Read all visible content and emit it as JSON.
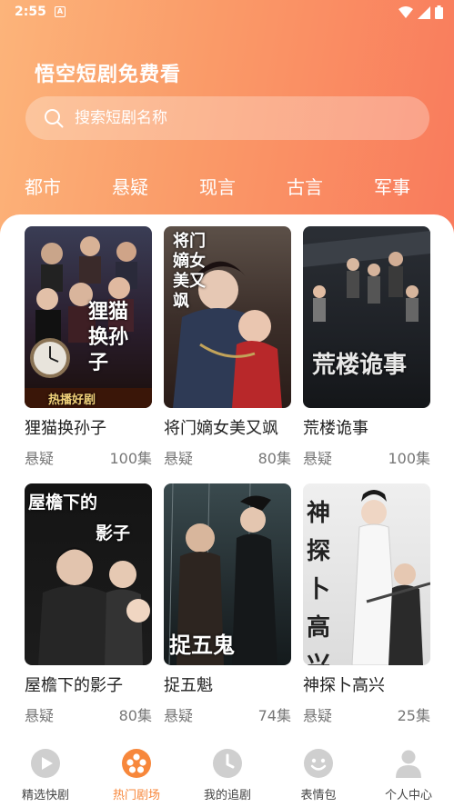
{
  "status_bar": {
    "time": "2:55",
    "notification_glyph": "A"
  },
  "header": {
    "app_title": "悟空短剧免费看",
    "search_placeholder": "搜索短剧名称"
  },
  "categories": [
    "都市",
    "悬疑",
    "现言",
    "古言",
    "军事"
  ],
  "dramas": [
    {
      "title": "狸猫换孙子",
      "genre": "悬疑",
      "episodes": "100集",
      "cover_text": "狸猫换孙子",
      "cover_tag": "热播好剧"
    },
    {
      "title": "将门嫡女美又飒",
      "genre": "悬疑",
      "episodes": "80集",
      "cover_text": "将门嫡女美又飒"
    },
    {
      "title": "荒楼诡事",
      "genre": "悬疑",
      "episodes": "100集",
      "cover_text": "荒楼诡事"
    },
    {
      "title": "屋檐下的影子",
      "genre": "悬疑",
      "episodes": "80集",
      "cover_text_1": "屋檐下的",
      "cover_text_2": "影子"
    },
    {
      "title": "捉五魁",
      "genre": "悬疑",
      "episodes": "74集",
      "cover_text": "捉五鬼"
    },
    {
      "title": "神探卜高兴",
      "genre": "悬疑",
      "episodes": "25集",
      "cover_text": "神探卜高兴"
    }
  ],
  "bottom_nav": [
    {
      "label": "精选快剧",
      "icon": "play-circle-icon"
    },
    {
      "label": "热门剧场",
      "icon": "film-reel-icon",
      "active": true
    },
    {
      "label": "我的追剧",
      "icon": "clock-icon"
    },
    {
      "label": "表情包",
      "icon": "smiley-icon"
    },
    {
      "label": "个人中心",
      "icon": "person-icon"
    }
  ],
  "colors": {
    "header_gradient_start": "#fcb47a",
    "header_gradient_end": "#f97a5c",
    "active_tab": "#f7873b",
    "inactive_icon": "#cfcfcf"
  }
}
